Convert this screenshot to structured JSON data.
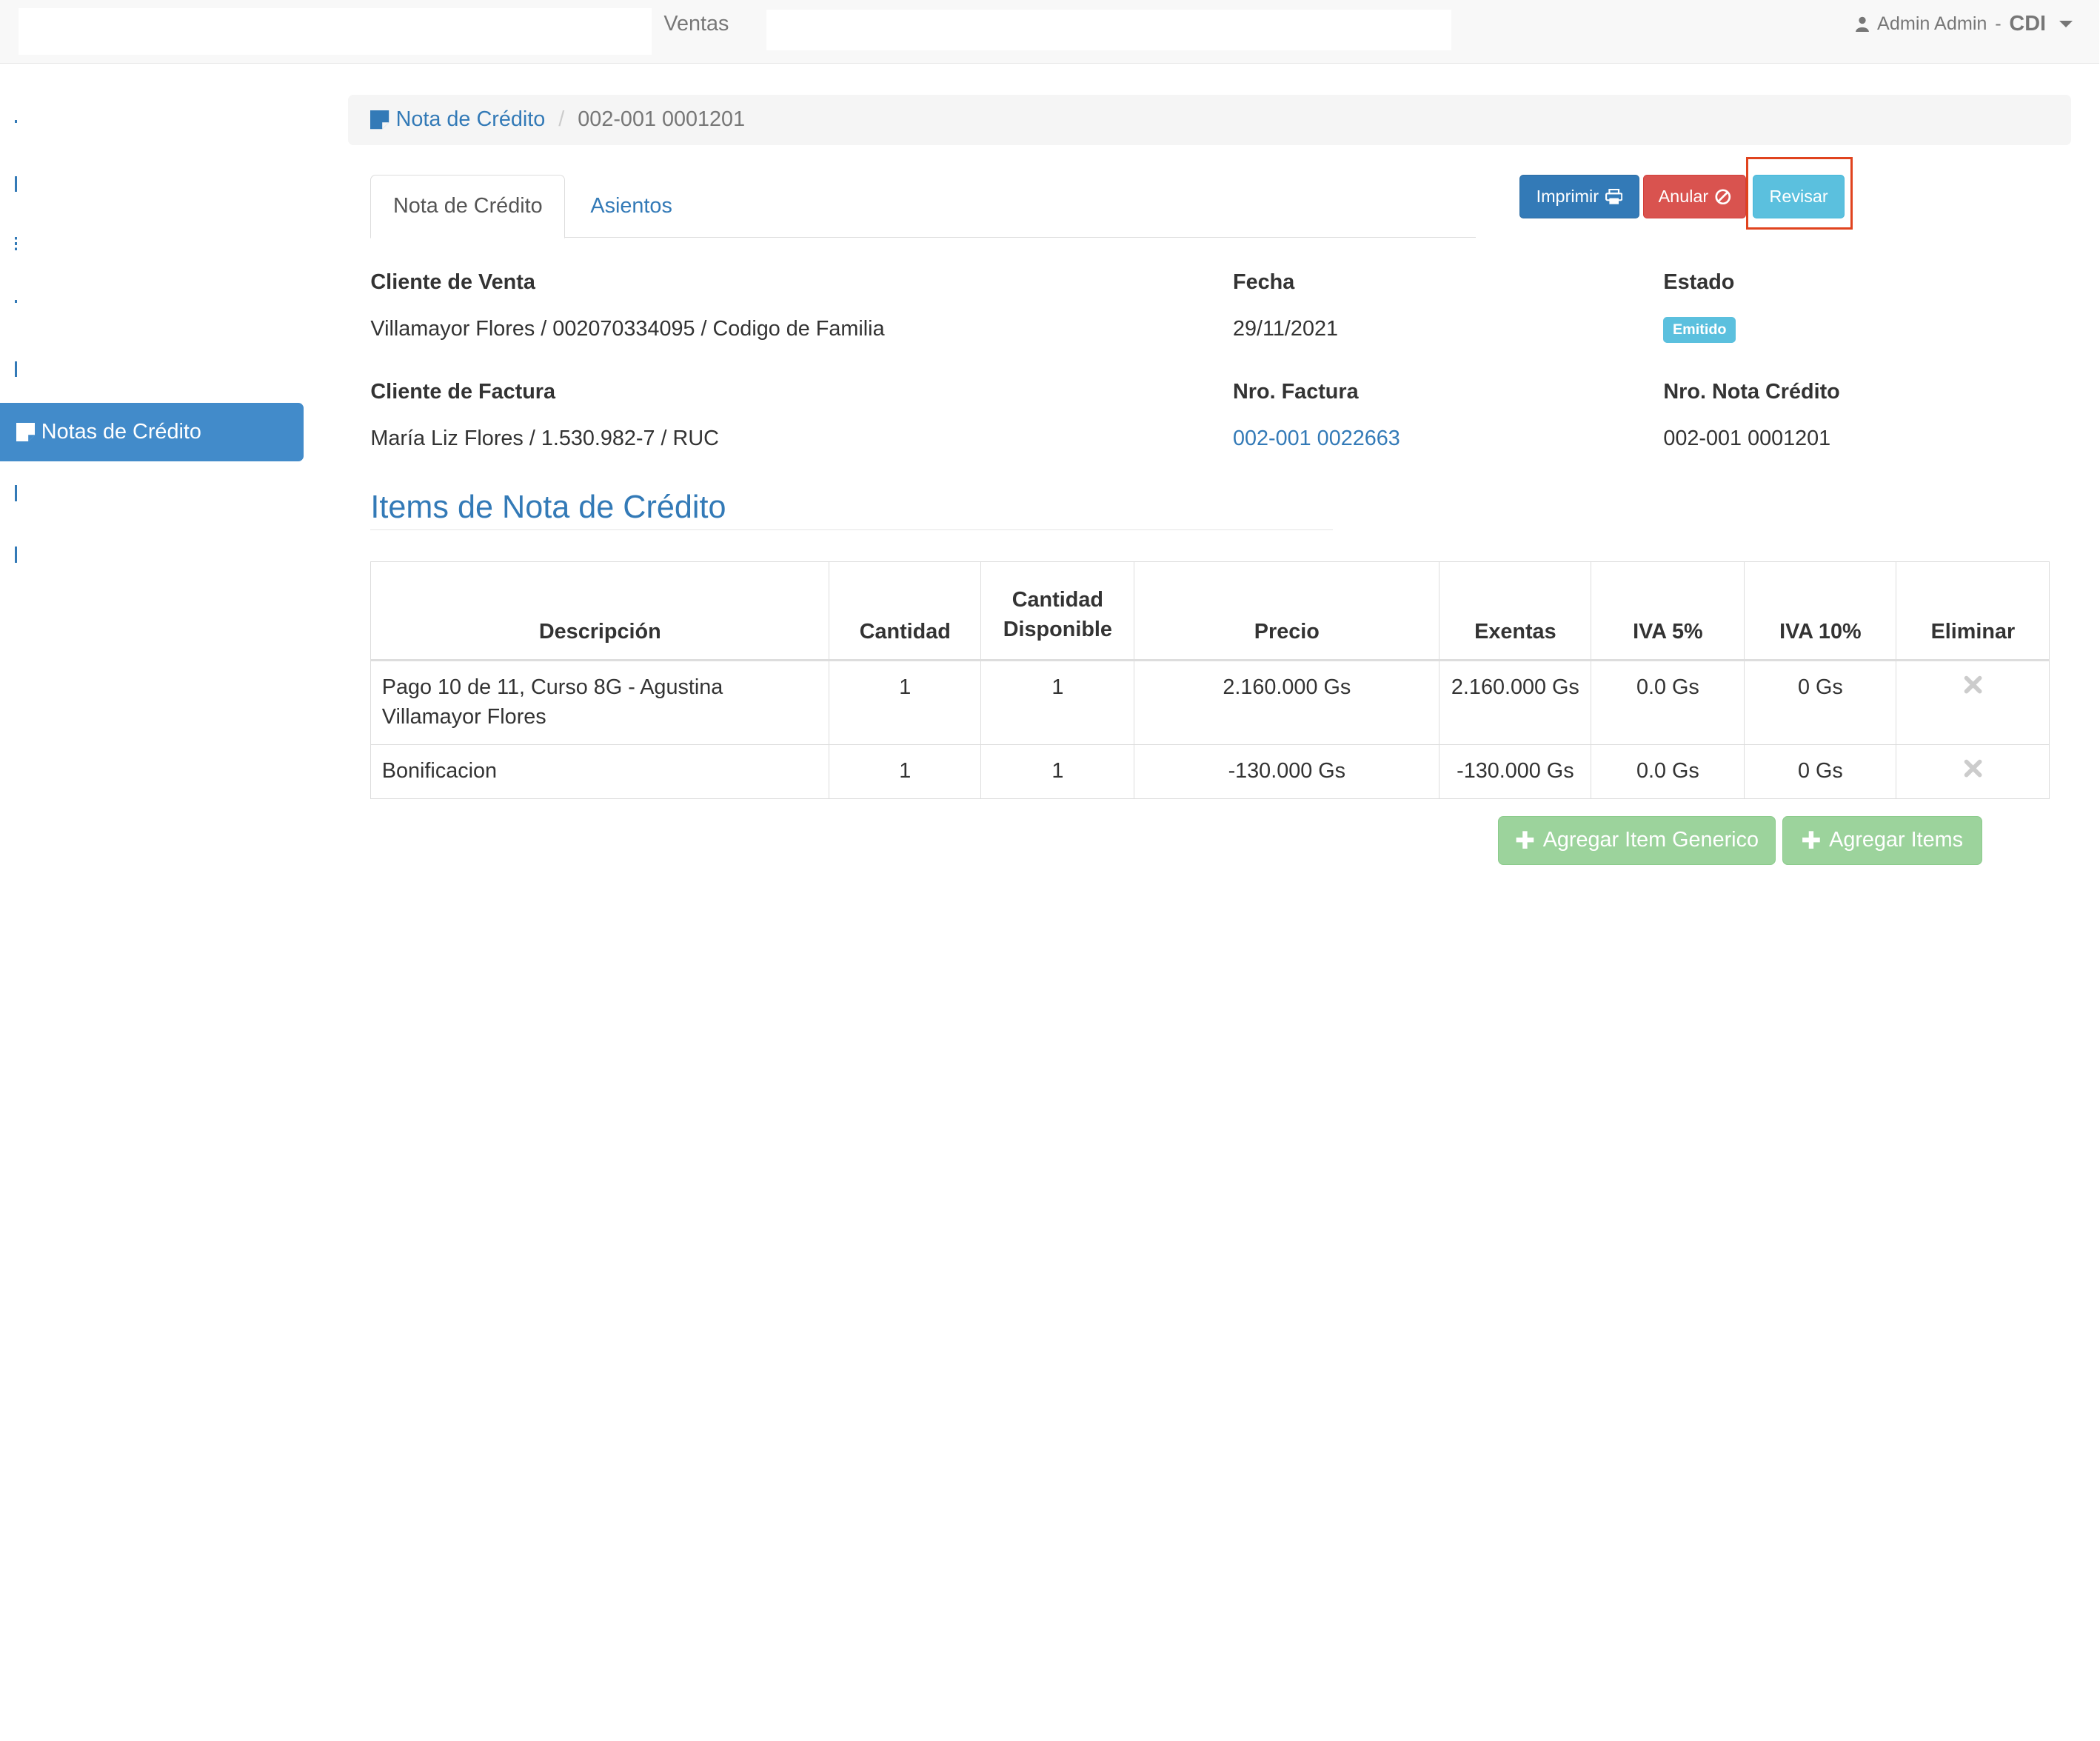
{
  "navbar": {
    "section": "Ventas",
    "user_name": "Admin Admin",
    "company_sep": "-",
    "company": "CDI"
  },
  "sidebar": {
    "active_item": "Notas de Crédito"
  },
  "breadcrumb": {
    "parent": "Nota de Crédito",
    "separator": "/",
    "current": "002-001 0001201"
  },
  "tabs": [
    {
      "label": "Nota de Crédito"
    },
    {
      "label": "Asientos"
    }
  ],
  "actions": {
    "print": "Imprimir",
    "cancel": "Anular",
    "review": "Revisar"
  },
  "details": {
    "sale_client_label": "Cliente de Venta",
    "sale_client_value": "Villamayor Flores / 002070334095 / Codigo de Familia",
    "date_label": "Fecha",
    "date_value": "29/11/2021",
    "status_label": "Estado",
    "status_value": "Emitido",
    "invoice_client_label": "Cliente de Factura",
    "invoice_client_value": "María Liz Flores / 1.530.982-7 / RUC",
    "invoice_no_label": "Nro. Factura",
    "invoice_no_value": "002-001 0022663",
    "credit_note_no_label": "Nro. Nota Crédito",
    "credit_note_no_value": "002-001 0001201"
  },
  "items_section": {
    "title": "Items de Nota de Crédito",
    "columns": {
      "description": "Descripción",
      "quantity": "Cantidad",
      "available_1": "Cantidad",
      "available_2": "Disponible",
      "price": "Precio",
      "exempt": "Exentas",
      "iva5": "IVA 5%",
      "iva10": "IVA 10%",
      "delete": "Eliminar"
    },
    "rows": [
      {
        "description": "Pago 10 de 11, Curso 8G - Agustina Villamayor Flores",
        "quantity": "1",
        "available": "1",
        "price": "2.160.000 Gs",
        "exempt": "2.160.000 Gs",
        "iva5": "0.0 Gs",
        "iva10": "0 Gs"
      },
      {
        "description": "Bonificacion",
        "quantity": "1",
        "available": "1",
        "price": "-130.000 Gs",
        "exempt": "-130.000 Gs",
        "iva5": "0.0 Gs",
        "iva10": "0 Gs"
      }
    ]
  },
  "footer_actions": {
    "add_generic": "Agregar Item Generico",
    "add_items": "Agregar Items"
  },
  "colors": {
    "primary": "#337ab7",
    "danger": "#d9534f",
    "info": "#5bc0de",
    "success_disabled": "#9cd39c",
    "highlight": "#e0431e"
  }
}
